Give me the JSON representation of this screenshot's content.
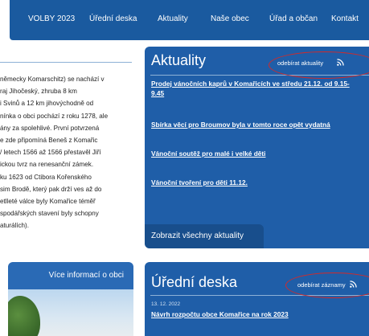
{
  "nav": {
    "items": [
      "VOLBY 2023",
      "Úřední deska",
      "Aktuality",
      "Naše obec",
      "Úřad a občan",
      "Kontakt"
    ]
  },
  "history": {
    "lines": [
      "německy Komarschitz) se nachází v",
      "raj Jihočeský, zhruba 8 km",
      "i Svinů a 12 km jihovýchodně od",
      "nínka o obci pochází z roku 1278, ale",
      "ány za spolehlivé. První potvrzená",
      "e zde připomíná Beneš z Komařic",
      "/ letech 1566 až 1566 přestavěl Jiří",
      "ickou tvrz na renesanční zámek.",
      "ku 1623 od Ctibora Kořenského",
      "sim Brodě, který pak drží ves až do",
      "etlleté válce byly Komařice téměř",
      "spodářských stavení byly schopny",
      "aturálích)."
    ]
  },
  "news": {
    "title": "Aktuality",
    "subscribe": "odebírat aktuality",
    "items": [
      "Prodej vánočních kaprů v Komařicích ve středu 21.12. od 9.15-9.45",
      "Sbírka věcí pro Broumov byla v tomto roce opět vydatná",
      "Vánoční soutěž pro malé i velké děti",
      "Vánoční tvoření pro děti 11.12."
    ],
    "all_button": "Zobrazit všechny aktuality"
  },
  "info": {
    "button": "Více informací o obci"
  },
  "board": {
    "title": "Úřední deska",
    "subscribe": "odebírat záznamy",
    "date": "13. 12. 2022",
    "item": "Návrh rozpočtu obce Komařice na rok 2023"
  },
  "colors": {
    "nav_bg": "#1a5a9f",
    "panel_bg": "#1f5ea8",
    "annotation": "#d22a2a"
  },
  "icons": [
    "rss-icon"
  ]
}
